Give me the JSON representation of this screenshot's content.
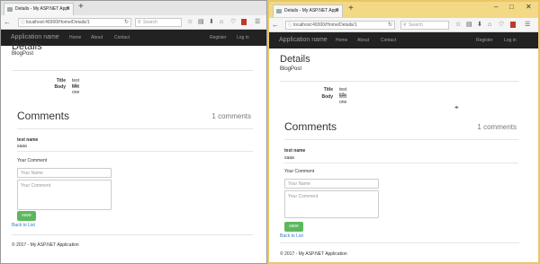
{
  "browser": {
    "tab_title": "Details - My ASP.NET Appli",
    "url": "localhost:49300/Home/Details/1",
    "search_placeholder": "Search"
  },
  "app": {
    "brand": "Application name",
    "nav": [
      "Home",
      "About",
      "Contact"
    ],
    "nav_right": [
      "Register",
      "Log in"
    ]
  },
  "details": {
    "title": "Details",
    "subtitle": "BlogPost",
    "fields": [
      {
        "label": "Title",
        "value": "test title"
      },
      {
        "label": "Body",
        "value": "test one"
      }
    ]
  },
  "comments": {
    "heading": "Comments",
    "count": "1 comments",
    "items": [
      {
        "name": "test name",
        "body": "saaa"
      }
    ],
    "form": {
      "label": "Your Comment",
      "name_placeholder": "Your Name",
      "comment_placeholder": "Your Comment",
      "submit": "save"
    }
  },
  "back_link": "Back to List",
  "footer": "© 2017 - My ASP.NET Application",
  "colors": {
    "navbar": "#222222",
    "button": "#5cb85c",
    "link": "#337ab7",
    "window_active_border": "#e8c766"
  }
}
